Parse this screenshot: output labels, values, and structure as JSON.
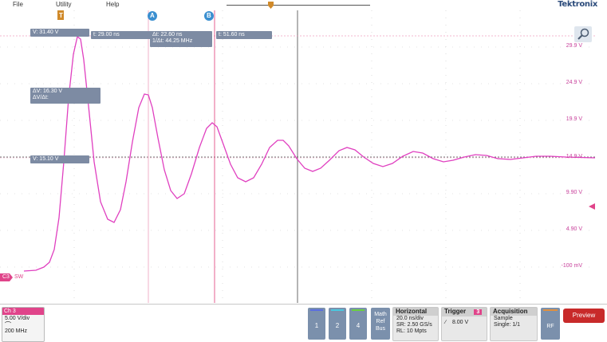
{
  "menu": {
    "file": "File",
    "utility": "Utility",
    "help": "Help"
  },
  "brand": "Tektronix",
  "readouts": {
    "v_top": "V:  31.40  V",
    "t_a": "t:   29.00  ns",
    "delta_t": "Δt:    22.60  ns",
    "inv_delta_t": "1/Δt:  44.25  MHz",
    "t_b": "t:   51.60  ns",
    "delta_v": "ΔV:    16.30  V",
    "delta_v_dt": "ΔV/Δt:",
    "v_bottom": "V:  15.10  V"
  },
  "cursor_labels": {
    "a": "A",
    "b": "B"
  },
  "trigger_marker": "T",
  "scale_labels": [
    "29.9 V",
    "24.9 V",
    "19.9 V",
    "14.9 V",
    "9.90 V",
    "4.90 V",
    "-100 mV"
  ],
  "channel_marker": {
    "ch": "C3",
    "name": "SW"
  },
  "ch3": {
    "title": "Ch 3",
    "vdiv": "5.00 V/div",
    "bw": "200 MHz"
  },
  "channel_buttons": [
    "1",
    "2",
    "4"
  ],
  "math_button": [
    "Math",
    "Ref",
    "Bus"
  ],
  "horizontal": {
    "title": "Horizontal",
    "tdiv": "20.0 ns/div",
    "sr": "SR: 2.50 GS/s",
    "rl": "RL: 10 Mpts"
  },
  "trigger": {
    "title": "Trigger",
    "channel": "3",
    "level": "8.00 V"
  },
  "acquisition": {
    "title": "Acquisition",
    "mode": "Sample",
    "single": "Single: 1/1"
  },
  "rf": "RF",
  "preview": "Preview",
  "colors": {
    "trace": "#e040c0",
    "cursor": "#e46090",
    "readout": "#7d8ba3",
    "preview": "#c82a2a",
    "ch3": "#e0448a"
  }
}
